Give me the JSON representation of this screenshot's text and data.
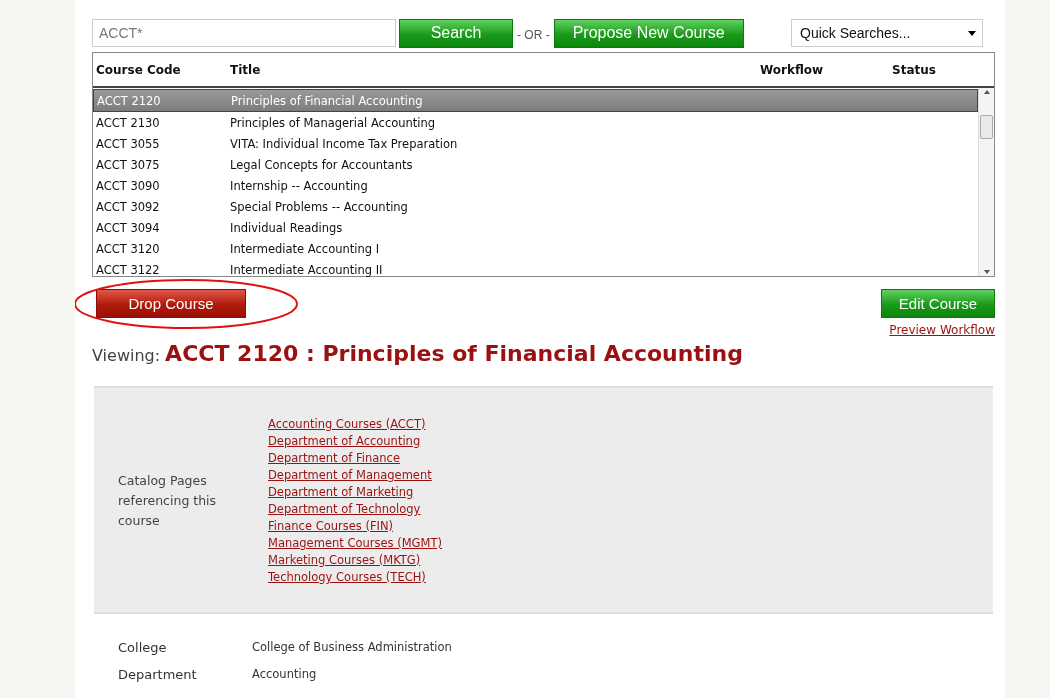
{
  "search": {
    "value": "ACCT*",
    "search_button": "Search",
    "or_label": "- OR -",
    "propose_button": "Propose New Course",
    "quick_searches": "Quick Searches..."
  },
  "table": {
    "columns": [
      "Course Code",
      "Title",
      "Workflow",
      "Status"
    ],
    "rows": [
      {
        "code": "ACCT 2120",
        "title": "Principles of Financial Accounting",
        "selected": true
      },
      {
        "code": "ACCT 2130",
        "title": "Principles of Managerial Accounting",
        "selected": false
      },
      {
        "code": "ACCT 3055",
        "title": "VITA: Individual Income Tax Preparation",
        "selected": false
      },
      {
        "code": "ACCT 3075",
        "title": "Legal Concepts for Accountants",
        "selected": false
      },
      {
        "code": "ACCT 3090",
        "title": "Internship -- Accounting",
        "selected": false
      },
      {
        "code": "ACCT 3092",
        "title": "Special Problems -- Accounting",
        "selected": false
      },
      {
        "code": "ACCT 3094",
        "title": "Individual Readings",
        "selected": false
      },
      {
        "code": "ACCT 3120",
        "title": "Intermediate Accounting I",
        "selected": false
      },
      {
        "code": "ACCT 3122",
        "title": "Intermediate Accounting II",
        "selected": false
      }
    ]
  },
  "actions": {
    "drop_button": "Drop Course",
    "edit_button": "Edit Course",
    "preview_link": "Preview Workflow"
  },
  "viewing": {
    "label": "Viewing:",
    "title": "ACCT 2120 : Principles of Financial Accounting"
  },
  "details": {
    "catalog_pages": {
      "label": "Catalog Pages referencing this course",
      "links": [
        "Accounting Courses (ACCT)",
        "Department of Accounting",
        "Department of Finance",
        "Department of Management",
        "Department of Marketing",
        "Department of Technology",
        "Finance Courses (FIN)",
        "Management Courses (MGMT)",
        "Marketing Courses (MKTG)",
        "Technology Courses (TECH)"
      ]
    },
    "fields": [
      {
        "label": "College",
        "value": "College of Business Administration"
      },
      {
        "label": "Department",
        "value": "Accounting"
      }
    ]
  }
}
